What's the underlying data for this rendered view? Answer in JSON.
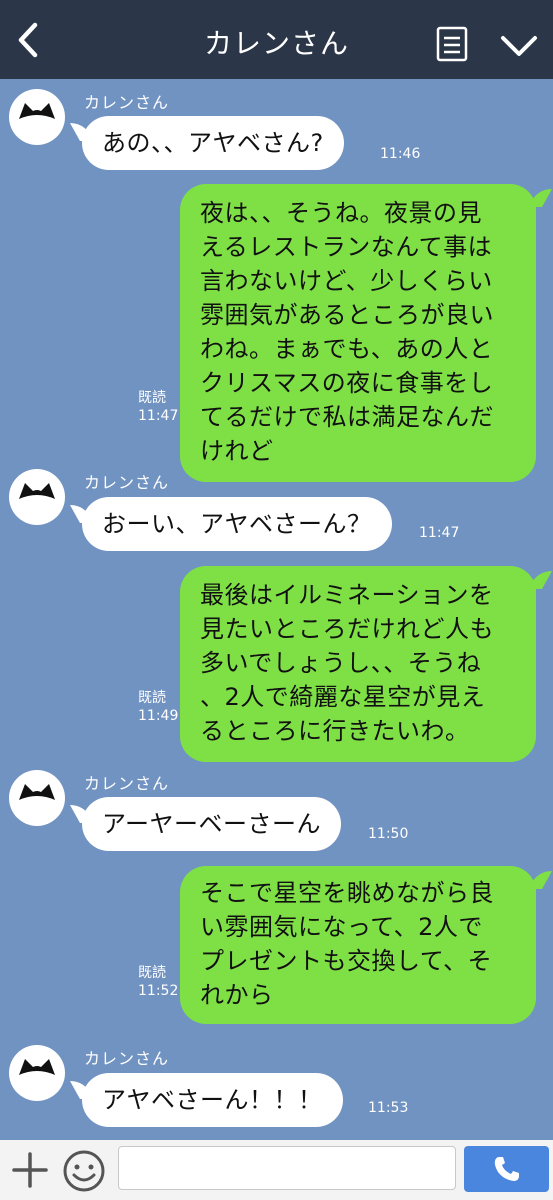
{
  "header": {
    "title": "カレンさん"
  },
  "messages": [
    {
      "type": "in",
      "sender": "カレンさん",
      "text": "あの、、アヤベさん?",
      "time": "11:46"
    },
    {
      "type": "out",
      "text": "夜は、、そうね。夜景の見えるレストランなんて事は言わないけど、少しくらい雰囲気があるところが良いわね。まぁでも、あの人とクリスマスの夜に食事をしてるだけで私は満足なんだけれど",
      "lines": [
        "夜は、、そうね。夜景の見",
        "えるレストランなんて事は",
        "言わないけど、少しくらい",
        "雰囲気があるところが良い",
        "わね。まぁでも、あの人と",
        "クリスマスの夜に食事をし",
        "てるだけで私は満足なんだ",
        "けれど"
      ],
      "read": "既読",
      "time": "11:47"
    },
    {
      "type": "in",
      "sender": "カレンさん",
      "text": "おーい、アヤベさーん？",
      "time": "11:47"
    },
    {
      "type": "out",
      "text": "最後はイルミネーションを見たいところだけれど人も多いでしょうし、、そうね、2人で綺麗な星空が見えるところに行きたいわ。",
      "lines": [
        "最後はイルミネーションを",
        "見たいところだけれど人も",
        "多いでしょうし、、そうね",
        "、2人で綺麗な星空が見え",
        "るところに行きたいわ。"
      ],
      "read": "既読",
      "time": "11:49"
    },
    {
      "type": "in",
      "sender": "カレンさん",
      "text": "アーヤーベーさーん",
      "time": "11:50"
    },
    {
      "type": "out",
      "text": "そこで星空を眺めながら良い雰囲気になって、2人でプレゼントも交換して、それから",
      "lines": [
        "そこで星空を眺めながら良",
        "い雰囲気になって、2人で",
        "プレゼントも交換して、そ",
        "れから"
      ],
      "read": "既読",
      "time": "11:52"
    },
    {
      "type": "in",
      "sender": "カレンさん",
      "text": "アヤベさーん！！！",
      "time": "11:53"
    }
  ],
  "input": {
    "placeholder": ""
  },
  "colors": {
    "header": "#2b3648",
    "background": "#7193c2",
    "outgoing": "#7fe046",
    "incoming": "#ffffff",
    "call": "#4a86dd"
  },
  "icons": {
    "back": "back-arrow-icon",
    "menu": "menu-list-icon",
    "collapse": "chevron-down-icon",
    "plus": "plus-icon",
    "sticker": "smile-icon",
    "call": "phone-icon"
  }
}
